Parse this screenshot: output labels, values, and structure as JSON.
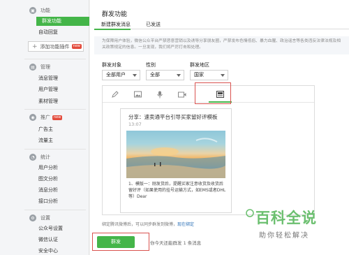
{
  "sidebar": {
    "sections": [
      {
        "title": "功能",
        "items": [
          "群发功能",
          "自动回复"
        ],
        "active": "群发功能"
      },
      {
        "title": "管理",
        "items": [
          "消息管理",
          "用户管理",
          "素材管理"
        ]
      },
      {
        "title": "推广",
        "badge": "new",
        "items": [
          "广告主",
          "流量主"
        ]
      },
      {
        "title": "统计",
        "items": [
          "用户分析",
          "图文分析",
          "消息分析",
          "接口分析"
        ]
      },
      {
        "title": "设置",
        "items": [
          "公众号设置",
          "微信认证",
          "安全中心"
        ]
      }
    ],
    "add_plugin_label": "添加功能插件",
    "add_plugin_badge": "new"
  },
  "main": {
    "title": "群发功能",
    "tabs": [
      "新建群发消息",
      "已发送"
    ],
    "notice": "为保障用户体验，微信公众平台严禁恶意营销以及诱导分享朋友圈，严禁发布色情低俗、暴力血腥、政治谣言等各类违反法律法规及相关政策规定的信息。一旦发现，我们将严厉打击和处理。",
    "filters": {
      "target_label": "群发对象",
      "target_value": "全部用户",
      "gender_label": "性别",
      "gender_value": "全部",
      "region_label": "群发地区",
      "region_value": "国家"
    },
    "card": {
      "title": "分享：速卖通平台引导买家留好评模板",
      "date": "13:07",
      "body": "1、模版一：刚发货后，提醒买家注意收货及收货后留好评（如果使用的挂号运输方式，如EMS或者DHL等）Dear"
    },
    "footer_tip": "绑定腾讯微博后，可以同步群发到微博，",
    "footer_link": "现在绑定",
    "send_label": "群发",
    "send_hint": "你今天还能群发 1 条消息"
  },
  "watermark": {
    "big": "百科全说",
    "small": "助你轻松解决"
  },
  "colors": {
    "accent": "#44b549",
    "highlight_box": "#d9534f"
  }
}
